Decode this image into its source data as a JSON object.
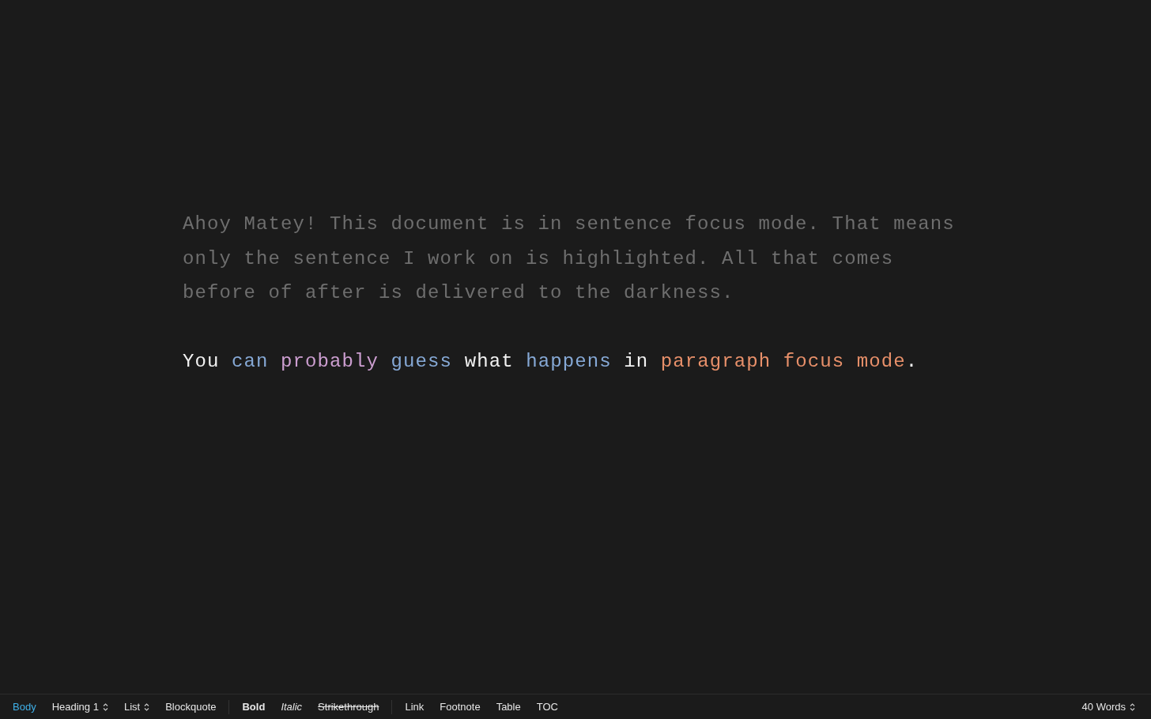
{
  "document": {
    "paragraphs": [
      {
        "words": [
          {
            "text": "Ahoy Matey! This document is in sentence focus mode. That means only the sentence I work on is highlighted. All that comes before of after is delivered to the darkness.",
            "color": "#6e6e6e"
          }
        ]
      },
      {
        "words": [
          {
            "text": "You",
            "color": "#f2f2f2"
          },
          {
            "text": "can",
            "color": "#86a9d6"
          },
          {
            "text": "probably",
            "color": "#cc9ed0"
          },
          {
            "text": "guess",
            "color": "#86a9d6"
          },
          {
            "text": "what",
            "color": "#f2f2f2"
          },
          {
            "text": "happens",
            "color": "#86a9d6"
          },
          {
            "text": "in",
            "color": "#f2f2f2"
          },
          {
            "text": "paragraph",
            "color": "#e8906a"
          },
          {
            "text": "focus",
            "color": "#e8906a"
          },
          {
            "text": "mode",
            "color": "#e8906a"
          },
          {
            "text": ".",
            "color": "#f2f2f2",
            "attached": true
          }
        ]
      }
    ]
  },
  "toolbar": {
    "groups": [
      [
        {
          "label": "Body",
          "kind": "style",
          "selected": true,
          "dropdown": false
        },
        {
          "label": "Heading 1",
          "kind": "style",
          "selected": false,
          "dropdown": true
        },
        {
          "label": "List",
          "kind": "style",
          "selected": false,
          "dropdown": true
        },
        {
          "label": "Blockquote",
          "kind": "style",
          "selected": false,
          "dropdown": false
        }
      ],
      [
        {
          "label": "Bold",
          "kind": "bold",
          "selected": false,
          "dropdown": false
        },
        {
          "label": "Italic",
          "kind": "italic",
          "selected": false,
          "dropdown": false
        },
        {
          "label": "Strikethrough",
          "kind": "strikethrough",
          "selected": false,
          "dropdown": false
        }
      ],
      [
        {
          "label": "Link",
          "kind": "insert",
          "selected": false,
          "dropdown": false
        },
        {
          "label": "Footnote",
          "kind": "insert",
          "selected": false,
          "dropdown": false
        },
        {
          "label": "Table",
          "kind": "insert",
          "selected": false,
          "dropdown": false
        },
        {
          "label": "TOC",
          "kind": "insert",
          "selected": false,
          "dropdown": false
        }
      ]
    ],
    "word_count": {
      "label": "40 Words",
      "dropdown": true
    }
  }
}
